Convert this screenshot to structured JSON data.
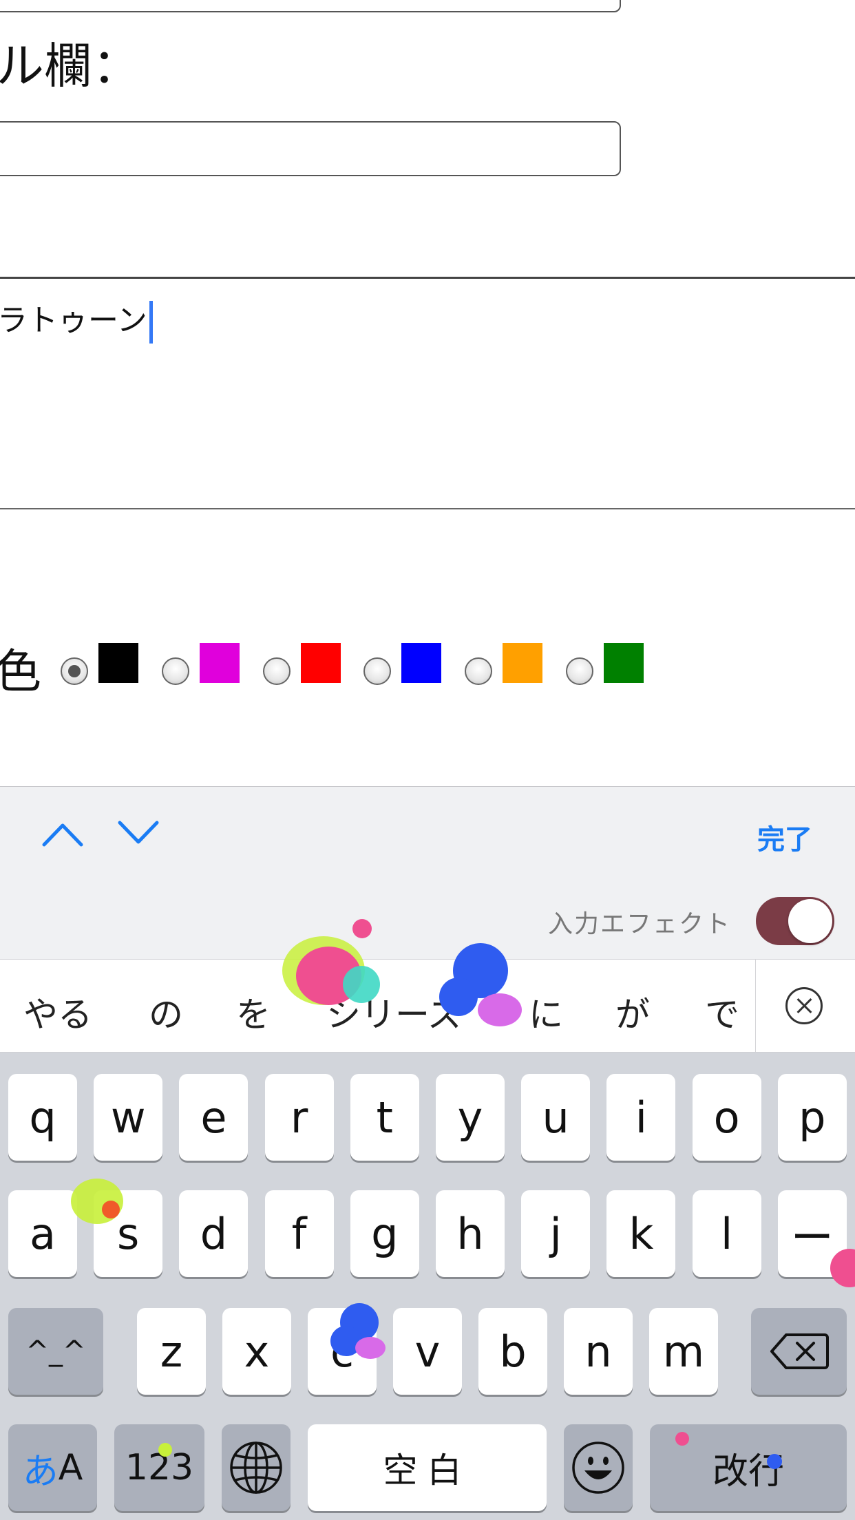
{
  "form": {
    "label_top": "ル欄：",
    "label_mid": "：",
    "textarea_value": "ラトゥーン",
    "color_label": "色",
    "colors": [
      {
        "hex": "#000000",
        "selected": true
      },
      {
        "hex": "#e000dc",
        "selected": false
      },
      {
        "hex": "#ff0000",
        "selected": false
      },
      {
        "hex": "#0000ff",
        "selected": false
      },
      {
        "hex": "#ffa000",
        "selected": false
      },
      {
        "hex": "#008000",
        "selected": false
      }
    ]
  },
  "accessory": {
    "prev_icon": "chevron-up-icon",
    "next_icon": "chevron-down-icon",
    "done_label": "完了"
  },
  "effect": {
    "label": "入力エフェクト",
    "toggle_on": true
  },
  "candidates": {
    "items": [
      "やる",
      "の",
      "を",
      "シリーズ",
      "に",
      "が",
      "で"
    ],
    "close_icon": "close-circle-icon"
  },
  "keyboard": {
    "row1": [
      "q",
      "w",
      "e",
      "r",
      "t",
      "y",
      "u",
      "i",
      "o",
      "p"
    ],
    "row2": [
      "a",
      "s",
      "d",
      "f",
      "g",
      "h",
      "j",
      "k",
      "l",
      "ー"
    ],
    "row3_left": "^_^",
    "row3": [
      "z",
      "x",
      "c",
      "v",
      "b",
      "n",
      "m"
    ],
    "backspace_icon": "backspace-icon",
    "kana_label_a": "あ",
    "kana_label_b": "A",
    "num_label": "123",
    "globe_icon": "globe-icon",
    "space_label": "空白",
    "emoji_icon": "emoji-icon",
    "return_label": "改行"
  },
  "colors": {
    "accent": "#1a7cf4",
    "toggle": "#7b3c46",
    "keyboard_bg": "#d2d5db",
    "dark_key": "#abb0bb"
  }
}
